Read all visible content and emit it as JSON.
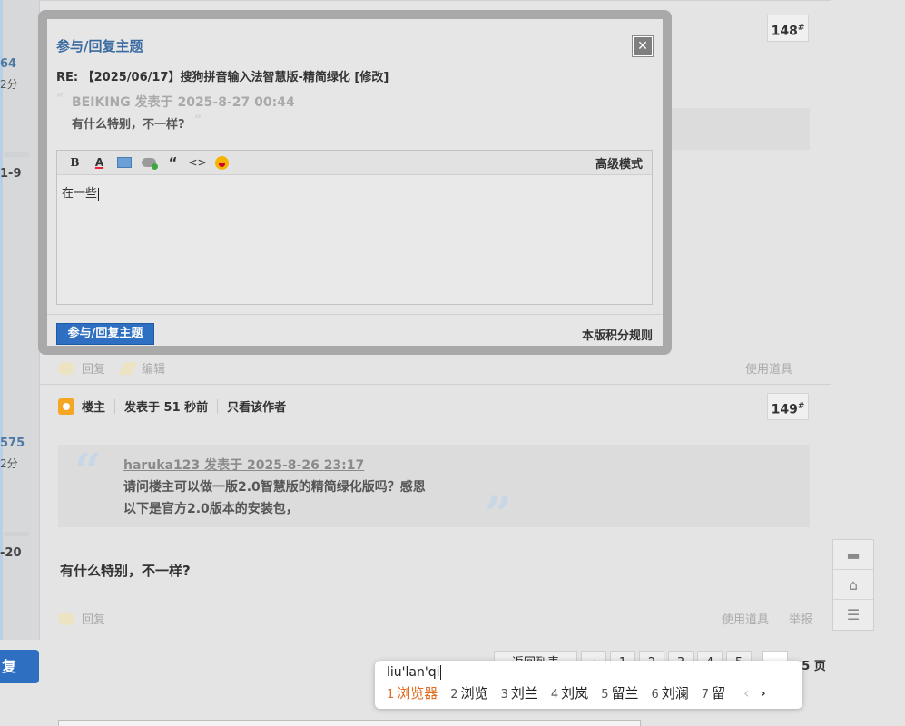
{
  "sidebar": {
    "frags": [
      "64",
      "2分",
      "1-9",
      "575",
      "2分",
      "-20"
    ]
  },
  "posts": {
    "floor_148": "148",
    "floor_149": "149",
    "floor_mark": "#",
    "post149": {
      "owner_label": "楼主",
      "posted": "发表于 51 秒前",
      "only_author": "只看该作者",
      "quote_author": "haruka123 发表于 2025-8-26 23:17",
      "quote_line1": "请问楼主可以做一版2.0智慧版的精简绿化版吗？感恩",
      "quote_line2": "以下是官方2.0版本的安装包，",
      "body": "有什么特别，不一样?",
      "reply": "回复",
      "use_tool": "使用道具",
      "report": "举报"
    },
    "post148_actions": {
      "reply": "回复",
      "edit": "编辑",
      "use_tool": "使用道具"
    }
  },
  "reply_button": "复",
  "pager": {
    "back": "返回列表",
    "pages": [
      "1",
      "2",
      "3",
      "4",
      "5"
    ],
    "total": "/ 5 页"
  },
  "side_tools": {
    "icons": [
      "comment-icon",
      "back-to-top-icon",
      "list-icon"
    ]
  },
  "modal": {
    "title": "参与/回复主题",
    "subject": "RE: 【2025/06/17】搜狗拼音输入法智慧版-精简绿化 [修改]",
    "quote_author": "BEIKING 发表于 2025-8-27 00:44",
    "quote_text": "有什么特别，不一样?",
    "toolbar": {
      "icons": [
        "bold-icon",
        "font-color-icon",
        "image-icon",
        "link-icon",
        "quote-icon",
        "code-icon",
        "emoji-icon"
      ],
      "bold_glyph": "B",
      "font_glyph": "A",
      "quote_glyph": "“",
      "code_glyph": "<>",
      "advanced_mode": "高级模式"
    },
    "content": "在一些",
    "submit": "参与/回复主题",
    "rules": "本版积分规则"
  },
  "ime": {
    "input": "liu'lan'qi",
    "candidates": [
      {
        "num": "1",
        "text": "浏览器",
        "active": true
      },
      {
        "num": "2",
        "text": "浏览"
      },
      {
        "num": "3",
        "text": "刘兰"
      },
      {
        "num": "4",
        "text": "刘岚"
      },
      {
        "num": "5",
        "text": "留兰"
      },
      {
        "num": "6",
        "text": "刘澜"
      },
      {
        "num": "7",
        "text": "留"
      }
    ],
    "prev": "‹",
    "next": "›"
  },
  "colors": {
    "accent_blue": "#2e6fc2",
    "link_blue": "#3a6aa0",
    "ime_active": "#e06a1e"
  }
}
